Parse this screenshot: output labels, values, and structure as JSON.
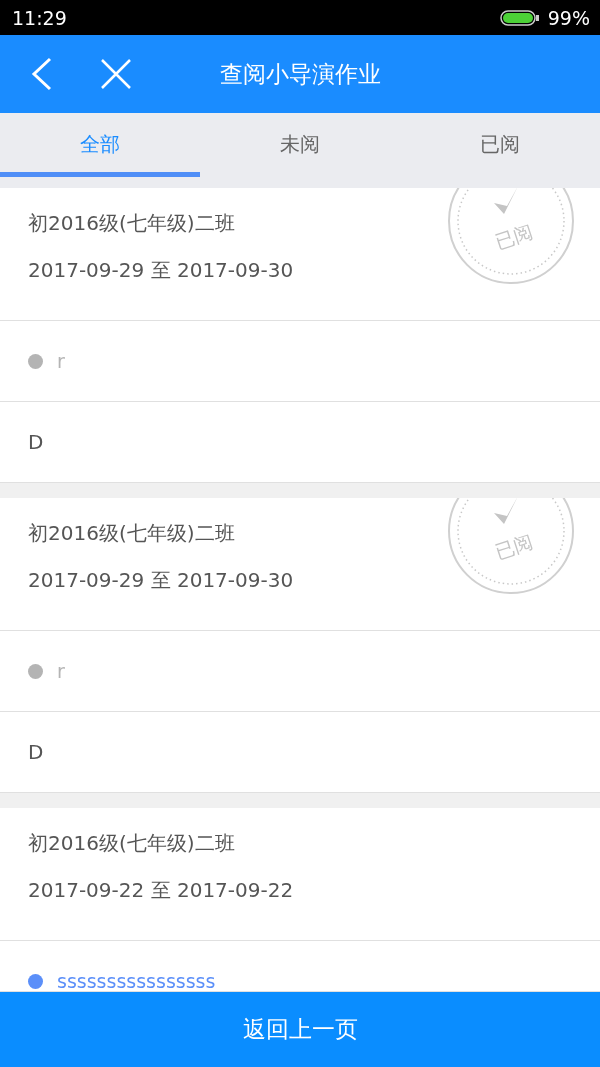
{
  "status_bar": {
    "time": "11:29",
    "battery": "99%"
  },
  "header": {
    "title": "查阅小导演作业"
  },
  "tabs": [
    {
      "label": "全部",
      "selected": true
    },
    {
      "label": "未阅",
      "selected": false
    },
    {
      "label": "已阅",
      "selected": false
    }
  ],
  "cards": [
    {
      "class": "初2016级(七年级)二班",
      "dates": "2017-09-29 至 2017-09-30",
      "read": true,
      "stamp": "已阅",
      "rows": [
        {
          "kind": "option",
          "text": "r",
          "color": "#b4b4b4"
        },
        {
          "kind": "answer",
          "text": "D"
        }
      ]
    },
    {
      "class": "初2016级(七年级)二班",
      "dates": "2017-09-29 至 2017-09-30",
      "read": true,
      "stamp": "已阅",
      "rows": [
        {
          "kind": "option",
          "text": "r",
          "color": "#b4b4b4"
        },
        {
          "kind": "answer",
          "text": "D"
        }
      ]
    },
    {
      "class": "初2016级(七年级)二班",
      "dates": "2017-09-22 至 2017-09-22",
      "read": false,
      "rows": [
        {
          "kind": "option",
          "text": "ssssssssssssssss",
          "color": "#5b8ff9"
        }
      ]
    }
  ],
  "footer_button": "返回上一页"
}
